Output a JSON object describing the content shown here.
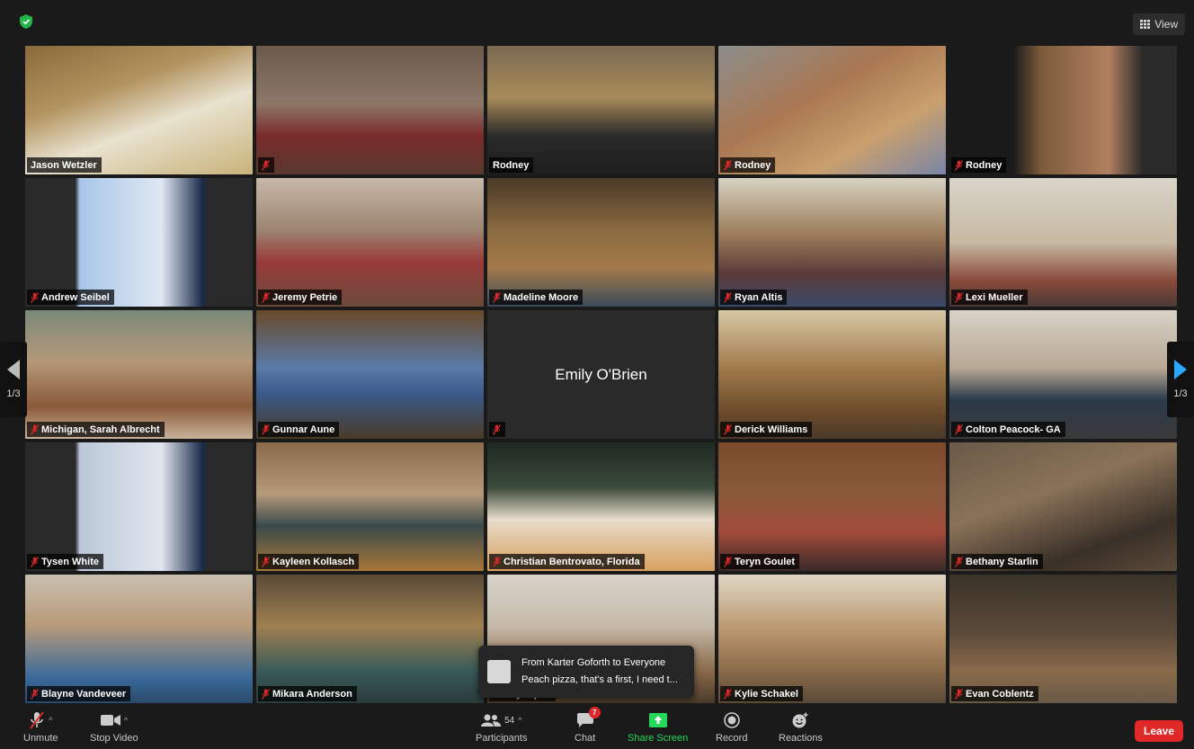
{
  "topbar": {
    "view_label": "View"
  },
  "tiles": [
    {
      "name": "Jason Wetzler",
      "muted": false
    },
    {
      "name": "",
      "muted": true
    },
    {
      "name": "Rodney",
      "muted": false
    },
    {
      "name": "Rodney",
      "muted": true
    },
    {
      "name": "Rodney",
      "muted": true
    },
    {
      "name": "Andrew Seibel",
      "muted": true
    },
    {
      "name": "Jeremy Petrie",
      "muted": true
    },
    {
      "name": "Madeline Moore",
      "muted": true
    },
    {
      "name": "Ryan Altis",
      "muted": true
    },
    {
      "name": "Lexi Mueller",
      "muted": true
    },
    {
      "name": "Michigan, Sarah Albrecht",
      "muted": true
    },
    {
      "name": "Gunnar Aune",
      "muted": true
    },
    {
      "name": "",
      "muted": true,
      "center_name": "Emily O'Brien"
    },
    {
      "name": "Derick Williams",
      "muted": true
    },
    {
      "name": "Colton Peacock- GA",
      "muted": true
    },
    {
      "name": "Tysen White",
      "muted": true
    },
    {
      "name": "Kayleen Kollasch",
      "muted": true
    },
    {
      "name": "Christian Bentrovato, Florida",
      "muted": true
    },
    {
      "name": "Teryn Goulet",
      "muted": true
    },
    {
      "name": "Bethany Starlin",
      "muted": true
    },
    {
      "name": "Blayne Vandeveer",
      "muted": true
    },
    {
      "name": "Mikara Anderson",
      "muted": true
    },
    {
      "name": "Bailey Sipes",
      "muted": false
    },
    {
      "name": "Kylie Schakel",
      "muted": true
    },
    {
      "name": "Evan Coblentz",
      "muted": true
    }
  ],
  "pager": {
    "left_label": "1/3",
    "right_label": "1/3"
  },
  "chat_popup": {
    "header": "From Karter Goforth to Everyone",
    "message": "Peach pizza, that's a first, I need t..."
  },
  "toolbar": {
    "unmute_label": "Unmute",
    "stop_video_label": "Stop Video",
    "participants_count": "54",
    "participants_label": "Participants",
    "chat_label": "Chat",
    "chat_badge": "7",
    "share_screen_label": "Share Screen",
    "record_label": "Record",
    "reactions_label": "Reactions",
    "leave_label": "Leave"
  },
  "colors": {
    "active_speaker": "#c6e03a",
    "share_green": "#23d959",
    "leave_red": "#e02828",
    "mute_red": "#e02828"
  }
}
